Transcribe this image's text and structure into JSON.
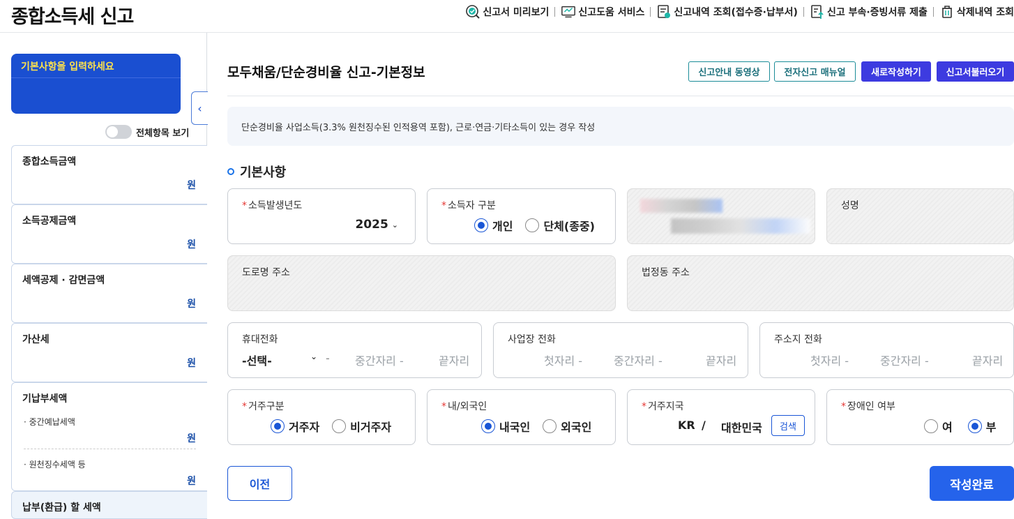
{
  "header": {
    "title": "종합소득세 신고",
    "menu": [
      {
        "label": "신고서 미리보기",
        "icon": "preview-check-icon"
      },
      {
        "label": "신고도움 서비스",
        "icon": "help-monitor-icon"
      },
      {
        "label": "신고내역 조회(접수증·납부서)",
        "icon": "history-doc-icon"
      },
      {
        "label": "신고 부속·증빙서류 제출",
        "icon": "upload-doc-icon"
      },
      {
        "label": "삭제내역 조회",
        "icon": "trash-icon"
      }
    ]
  },
  "sidebar": {
    "prompt": "기본사항을 입력하세요",
    "toggle_label": "전체항목 보기",
    "unit": "원",
    "items": [
      {
        "label": "종합소득금액"
      },
      {
        "label": "소득공제금액"
      },
      {
        "label": "세액공제 · 감면금액"
      },
      {
        "label": "가산세"
      },
      {
        "label": "기납부세액",
        "subs": [
          "· 중간예납세액",
          "· 원천징수세액 등"
        ]
      },
      {
        "label": "납부(환급) 할 세액"
      }
    ]
  },
  "main": {
    "title": "모두채움/단순경비율 신고-기본정보",
    "buttons": {
      "video": "신고안내 동영상",
      "manual": "전자신고 매뉴얼",
      "new": "새로작성하기",
      "load": "신고서불러오기"
    },
    "notice": "단순경비율 사업소득(3.3% 원천징수된 인적용역 포함), 근로·연금·기타소득이 있는 경우 작성",
    "section_title": "기본사항",
    "year": {
      "label": "소득발생년도",
      "value": "2025"
    },
    "income_type": {
      "label": "소득자 구분",
      "options": [
        "개인",
        "단체(종중)"
      ],
      "selected": 0
    },
    "name_label": "성명",
    "road_address_label": "도로명 주소",
    "legal_address_label": "법정동 주소",
    "mobile": {
      "label": "휴대전화",
      "select": "-선택-",
      "sep": "-",
      "mid": "중간자리 -",
      "end": "끝자리"
    },
    "biz_phone": {
      "label": "사업장 전화",
      "first": "첫자리 -",
      "mid": "중간자리 -",
      "end": "끝자리"
    },
    "home_phone": {
      "label": "주소지 전화",
      "first": "첫자리 -",
      "mid": "중간자리 -",
      "end": "끝자리"
    },
    "residency": {
      "label": "거주구분",
      "options": [
        "거주자",
        "비거주자"
      ],
      "selected": 0
    },
    "nationality": {
      "label": "내/외국인",
      "options": [
        "내국인",
        "외국인"
      ],
      "selected": 0
    },
    "country": {
      "label": "거주지국",
      "code": "KR",
      "slash": "/",
      "name": "대한민국",
      "search": "검색"
    },
    "disability": {
      "label": "장애인 여부",
      "options": [
        "여",
        "부"
      ],
      "selected": 1
    },
    "prev": "이전",
    "done": "작성완료"
  }
}
